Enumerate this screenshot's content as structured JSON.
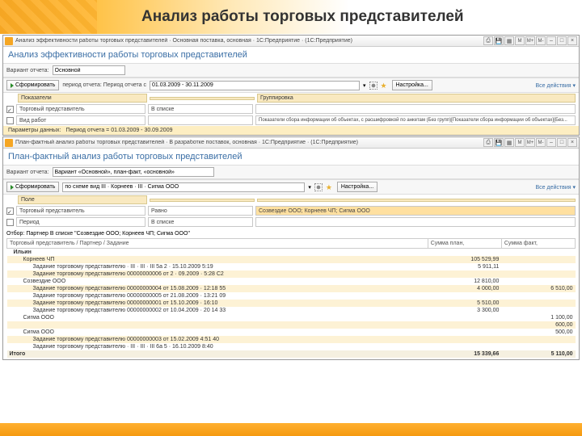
{
  "header": {
    "title": "Анализ работы торговых представителей"
  },
  "win1": {
    "titlebar": "Анализ эффективности работы торговых представителей · Основная поставка, основная · 1С:Предприятие · (1С:Предприятие)",
    "buttons": [
      "M",
      "M+",
      "M-",
      "–",
      "□",
      "×"
    ],
    "report_title": "Анализ эффективности работы торговых представителей",
    "variant_label": "Вариант отчета:",
    "variant_value": "Основной",
    "form_label": "Сформировать",
    "period_label": "период отчета: Период отчета с",
    "period_value": "01.03.2009 - 30.11.2009",
    "settings_label": "Настройка...",
    "all_actions": "Все действия ▾",
    "filters": {
      "h1": "Показатели",
      "h2": "Группировка",
      "r1c1": "Торговый представитель",
      "r1c2": "В списке",
      "r2c1": "Вид работ",
      "r3c1": "Показатели сбора информации об объектах, с расшифровкой по анкетам (Без групп)[Показатели сбора информации об объектах]{Без..."
    },
    "yellow": {
      "label": "Параметры данных:",
      "value": "Период отчета = 01.03.2009 - 30.09.2009"
    }
  },
  "win2": {
    "titlebar": "План-фактный анализ работы торговых представителей · В разработке поставок, основная · 1С:Предприятие · (1С:Предприятие)",
    "buttons": [
      "M",
      "M+",
      "M-",
      "–",
      "□",
      "×"
    ],
    "report_title": "План-фактный анализ работы торговых представителей",
    "variant_label": "Вариант отчета:",
    "variant_value": "Вариант «Основной», план-факт, «основной»",
    "form_label": "Сформировать",
    "scheme_label": "по схеме вид III · Корнеев · III · Сигма ООО",
    "settings_label": "Настройка...",
    "all_actions": "Все действия ▾",
    "filters": {
      "h1": "Поле",
      "r1c1": "Торговый представитель",
      "r2c1": "Период",
      "r1c2": "Равно",
      "r2c2": "В списке",
      "r3": "Созвездие ООО; Корнеев ЧП; Сигма ООО"
    },
    "report": {
      "selection_label": "Отбор:",
      "selection_value": "Партнер В списке \"Созвездие ООО; Корнеев ЧП; Сигма ООО\"",
      "cols": [
        "Торговый представитель / Партнер / Задание",
        "Сумма план,",
        "Сумма факт,"
      ],
      "rows": [
        {
          "lvl": 0,
          "alt": 0,
          "c": [
            "Ильин",
            "",
            " "
          ]
        },
        {
          "lvl": 1,
          "alt": 1,
          "c": [
            "Корнеев ЧП",
            "105 529,99",
            ""
          ]
        },
        {
          "lvl": 2,
          "alt": 0,
          "c": [
            "Задание торговому представителю · III · III · III 5a 2 · 15.10.2009 5:19",
            "5 911,11",
            ""
          ]
        },
        {
          "lvl": 2,
          "alt": 1,
          "c": [
            "Задание торговому представителю 00000000006 от 2 · 09.2009 · 5:28 С2",
            "",
            ""
          ]
        },
        {
          "lvl": 1,
          "alt": 0,
          "c": [
            "Созвездие ООО",
            "12 810,00",
            ""
          ]
        },
        {
          "lvl": 2,
          "alt": 1,
          "c": [
            "Задание торговому представителю 00000000004 от 15.08.2009 · 12:18 55",
            "4 000,00",
            "6 510,00"
          ]
        },
        {
          "lvl": 2,
          "alt": 0,
          "c": [
            "Задание торговому представителю 00000000005 от 21.08.2009 · 13:21 09",
            "",
            ""
          ]
        },
        {
          "lvl": 2,
          "alt": 1,
          "c": [
            "Задание торговому представителю 00000000001 от 15.10.2009 · 16:10",
            "5 510,00",
            ""
          ]
        },
        {
          "lvl": 2,
          "alt": 0,
          "c": [
            "Задание торговому представителю 00000000002 от 10.04.2009 · 20 14 33",
            "3 300,00",
            ""
          ]
        },
        {
          "lvl": 1,
          "alt": 0,
          "c": [
            "Сигма ООО",
            "",
            "1 100,00"
          ]
        },
        {
          "lvl": 2,
          "alt": 1,
          "c": [
            "",
            "",
            "600,00"
          ]
        },
        {
          "lvl": 1,
          "alt": 0,
          "c": [
            "Сигма ООО",
            "",
            "500,00"
          ]
        },
        {
          "lvl": 2,
          "alt": 1,
          "c": [
            "Задание торговому представителю 00000000003 от 15.02.2009 4:51 40",
            "",
            ""
          ]
        },
        {
          "lvl": 2,
          "alt": 0,
          "c": [
            "Задание торговому представителю · III · III · III 6a 5 · 16.10.2009 8:40",
            "",
            ""
          ]
        }
      ],
      "total": [
        "Итого",
        "15 339,66",
        "5 110,00"
      ]
    }
  }
}
